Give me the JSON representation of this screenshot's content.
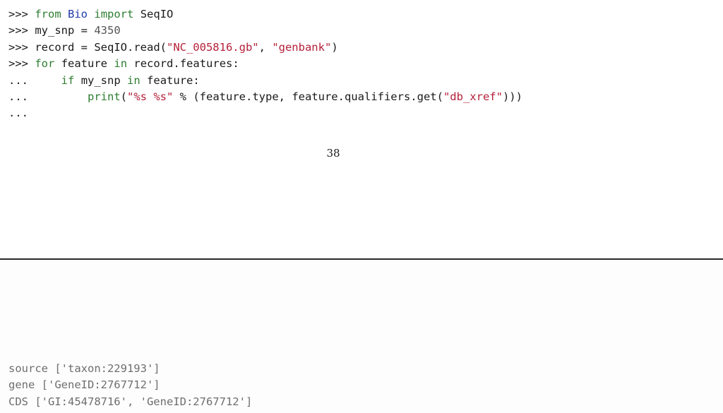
{
  "code": {
    "line1": {
      "prompt": ">>>",
      "kw_from": "from",
      "module": "Bio",
      "kw_import": "import",
      "name": "SeqIO"
    },
    "line2": {
      "prompt": ">>>",
      "lhs": "my_snp = ",
      "value": "4350"
    },
    "line3": {
      "prompt": ">>>",
      "lhs": "record = SeqIO.read(",
      "arg1": "\"NC_005816.gb\"",
      "sep": ", ",
      "arg2": "\"genbank\"",
      "close": ")"
    },
    "line4": {
      "prompt": ">>>",
      "kw_for": "for",
      "var": "feature",
      "kw_in": "in",
      "iter": "record.features:"
    },
    "line5": {
      "prompt": "...",
      "kw_if": "if",
      "var": "my_snp",
      "kw_in": "in",
      "rest": "feature:"
    },
    "line6": {
      "prompt": "...",
      "fn": "print",
      "open": "(",
      "fmt": "\"%s %s\"",
      "op": " % ",
      "args_pre": "(feature.type, feature.qualifiers.get(",
      "key": "\"db_xref\"",
      "args_post": ")))"
    },
    "line7": {
      "prompt": "..."
    }
  },
  "page_number": "38",
  "output": {
    "line1": "source ['taxon:229193']",
    "line2": "gene ['GeneID:2767712']",
    "line3": "CDS ['GI:45478716', 'GeneID:2767712']"
  }
}
